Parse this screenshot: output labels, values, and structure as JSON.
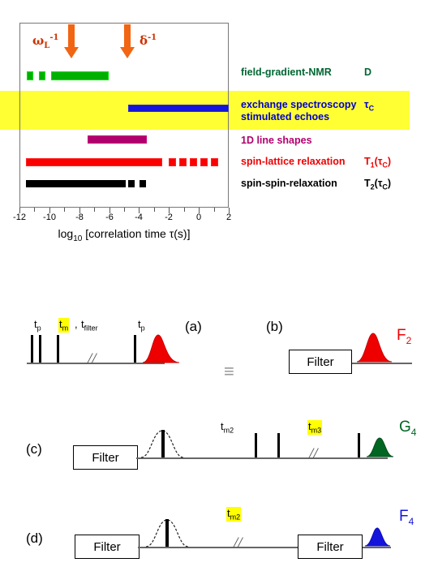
{
  "chart_data": {
    "type": "bar",
    "title": "",
    "xlabel": "log10 [correlation time τ(s)]",
    "ylabel": "",
    "xlim": [
      -12,
      2
    ],
    "xticks": [
      -12,
      -10,
      -8,
      -6,
      -4,
      -2,
      0,
      2
    ],
    "xticklabels": [
      "-12",
      "-10",
      "-8",
      "-6",
      "-4",
      "-2",
      "0",
      "2"
    ],
    "grid": false,
    "legend_position": "right",
    "orientation": "horizontal",
    "annotations": [
      {
        "name": "omega-L-inverse",
        "label": "ωL⁻¹",
        "x": -8.9,
        "color": "#cc3300"
      },
      {
        "name": "delta-inverse",
        "label": "δ⁻¹",
        "x": -5.2,
        "color": "#cc3300"
      }
    ],
    "series": [
      {
        "name": "field-gradient-NMR",
        "label": "field-gradient-NMR",
        "symbol": "D",
        "color": "#00b000",
        "segments": [
          {
            "start": -11.5,
            "end": -11.1,
            "style": "dash"
          },
          {
            "start": -10.7,
            "end": -10.3,
            "style": "dash"
          },
          {
            "start": -9.9,
            "end": -6.1,
            "style": "solid"
          }
        ]
      },
      {
        "name": "exchange-spectroscopy-stimulated-echoes",
        "label": "exchange spectroscopy",
        "label2": "stimulated echoes",
        "symbol": "τC",
        "color": "#1414dc",
        "highlighted": true,
        "segments": [
          {
            "start": -4.7,
            "end": 2.0,
            "style": "solid"
          }
        ]
      },
      {
        "name": "1D-line-shapes",
        "label": "1D line shapes",
        "symbol": "",
        "color": "#b0006e",
        "segments": [
          {
            "start": -7.4,
            "end": -3.5,
            "style": "solid"
          }
        ]
      },
      {
        "name": "spin-lattice-relaxation",
        "label": "spin-lattice relaxation",
        "symbol": "T1(τC)",
        "color": "#fb0000",
        "segments": [
          {
            "start": -11.6,
            "end": -2.5,
            "style": "solid"
          },
          {
            "start": -2.1,
            "end": -1.8,
            "style": "dash"
          },
          {
            "start": -1.4,
            "end": -1.1,
            "style": "dash"
          },
          {
            "start": -0.7,
            "end": -0.4,
            "style": "dash"
          },
          {
            "start": 0.0,
            "end": 0.3,
            "style": "dash"
          },
          {
            "start": 0.7,
            "end": 1.0,
            "style": "dash"
          }
        ]
      },
      {
        "name": "spin-spin-relaxation",
        "label": "spin-spin-relaxation",
        "symbol": "T2(τC)",
        "color": "#000000",
        "segments": [
          {
            "start": -11.6,
            "end": -4.9,
            "style": "solid"
          },
          {
            "start": -4.5,
            "end": -4.2,
            "style": "dash"
          },
          {
            "start": -3.6,
            "end": -3.3,
            "style": "dash"
          }
        ]
      }
    ]
  },
  "top_panel": {
    "axis_title_main": "log",
    "axis_title_sub": "10",
    "axis_title_rest": " [correlation time τ(s)]",
    "arrow_label_1_base": "ω",
    "arrow_label_1_sub": "L",
    "arrow_label_1_sup": "-1",
    "arrow_label_2_base": "δ",
    "arrow_label_2_sup": "-1",
    "legend": [
      {
        "text": "field-gradient-NMR",
        "symbol": "D",
        "symbol_sub": ""
      },
      {
        "text": "exchange spectroscopy",
        "text2": "stimulated echoes",
        "symbol": "τ",
        "symbol_sub": "C"
      },
      {
        "text": "1D line shapes",
        "symbol": "",
        "symbol_sub": ""
      },
      {
        "text": "spin-lattice relaxation",
        "symbol": "T",
        "symbol_sub": "1",
        "symbol_tail": "(τ",
        "symbol_tail_sub": "C",
        "symbol_tail_end": ")"
      },
      {
        "text": "spin-spin-relaxation",
        "symbol": "T",
        "symbol_sub": "2",
        "symbol_tail": "(τ",
        "symbol_tail_sub": "C",
        "symbol_tail_end": ")"
      }
    ]
  },
  "sequences": {
    "equivalence_symbol": "≡",
    "break_symbol": "//",
    "filter_label": "Filter",
    "panel_a": {
      "id": "(a)",
      "labels": {
        "tp1_base": "t",
        "tp1_sub": "p",
        "tm_base": "t",
        "tm_sub": "m",
        "comma": ",",
        "tfilter_base": "t",
        "tfilter_sub": "filter",
        "tp2_base": "t",
        "tp2_sub": "p"
      }
    },
    "panel_b": {
      "id": "(b)",
      "filter": "Filter",
      "peak_base": "F",
      "peak_sub": "2",
      "peak_color": "#ee0000"
    },
    "panel_c": {
      "id": "(c)",
      "filter": "Filter",
      "tm2_base": "t",
      "tm2_sub": "m2",
      "tm3_base": "t",
      "tm3_sub": "m3",
      "peak_base": "G",
      "peak_sub": "4",
      "peak_color": "#006622"
    },
    "panel_d": {
      "id": "(d)",
      "filter1": "Filter",
      "filter2": "Filter",
      "tm2_base": "t",
      "tm2_sub": "m2",
      "peak_base": "F",
      "peak_sub": "4",
      "peak_color": "#1414dc"
    }
  },
  "colors": {
    "highlight": "#ffff00",
    "band": "#ffff33",
    "green": "#00b000",
    "blue": "#1414dc",
    "purple": "#b0006e",
    "red": "#fb0000",
    "black": "#000000",
    "arrow_orange": "#f26512",
    "greek_orange": "#cc3300"
  }
}
